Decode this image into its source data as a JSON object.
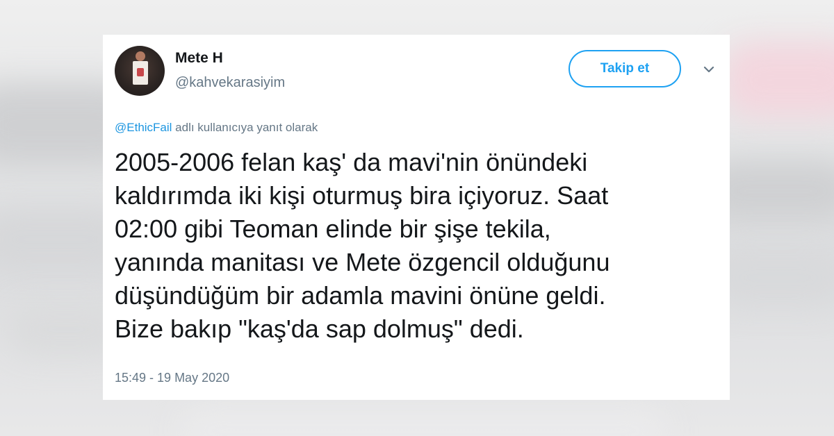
{
  "tweet": {
    "display_name": "Mete H",
    "handle": "@kahvekarasiyim",
    "follow_label": "Takip et",
    "more_icon": "chevron-down-icon",
    "reply_mention": "@EthicFail",
    "reply_suffix": " adlı kullanıcıya yanıt olarak",
    "text": "2005-2006 felan kaş' da mavi'nin önündeki\nkaldırımda iki kişi oturmuş bira içiyoruz. Saat\n02:00 gibi Teoman elinde bir şişe tekila,\nyanında manitası ve Mete özgencil olduğunu\ndüşündüğüm bir adamla mavini önüne geldi.\nBize bakıp \"kaş'da sap dolmuş\" dedi.",
    "timestamp": "15:49 - 19 May 2020"
  },
  "colors": {
    "accent": "#1da1f2",
    "mention": "#1b95e0",
    "secondary_text": "#657786",
    "primary_text": "#14171a",
    "card_background": "#ffffff"
  }
}
